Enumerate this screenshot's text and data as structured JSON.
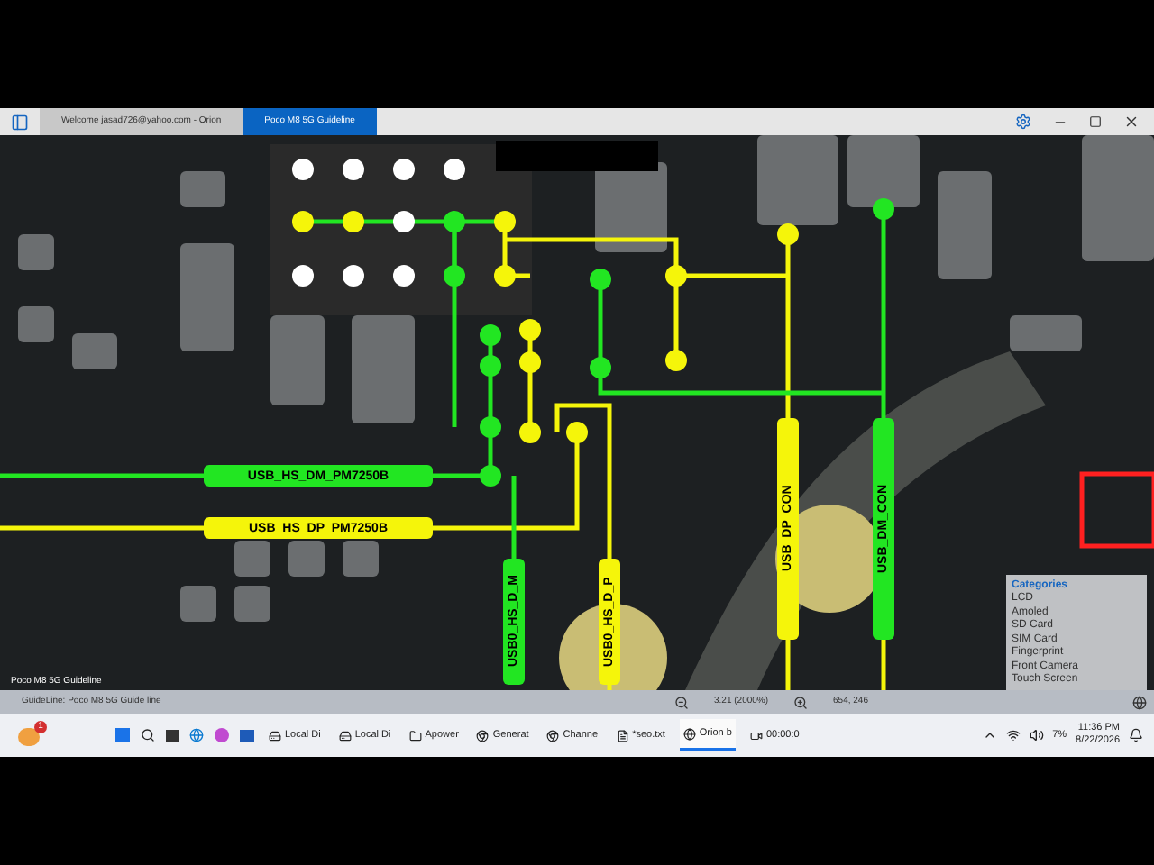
{
  "window": {
    "tabs": [
      {
        "label": "Welcome jasad726@yahoo.com - Orion",
        "selected": false
      },
      {
        "label": "Poco M8 5G Guideline",
        "selected": true
      }
    ]
  },
  "canvas": {
    "caption": "Poco M8 5G Guideline",
    "nets": [
      {
        "label": "USB_HS_DM_PM7250B",
        "kind": "horizontal",
        "color": "#22e622"
      },
      {
        "label": "USB_HS_DP_PM7250B",
        "kind": "horizontal",
        "color": "#f5f50a"
      },
      {
        "label": "USB_DP_CON",
        "kind": "vertical",
        "color": "#f5f50a"
      },
      {
        "label": "USB_DM_CON",
        "kind": "vertical",
        "color": "#22e622"
      },
      {
        "label": "USB0_HS_D_M",
        "kind": "vertical",
        "color": "#22e622"
      },
      {
        "label": "USB0_HS_D_P",
        "kind": "vertical",
        "color": "#f5f50a"
      }
    ]
  },
  "categories": {
    "title": "Categories",
    "items": [
      "LCD",
      "Amoled",
      "SD Card",
      "SIM Card",
      "Fingerprint",
      "Front Camera",
      "Touch Screen"
    ]
  },
  "status_bar": {
    "guideline": "GuideLine: Poco M8 5G Guide line",
    "zoom": "3.21 (2000%)",
    "coords": "654, 246"
  },
  "taskbar": {
    "notification_count": "1",
    "apps": [
      {
        "label": "Local Di",
        "kind": "drive",
        "active": false
      },
      {
        "label": "Local Di",
        "kind": "drive",
        "active": false
      },
      {
        "label": "Apower",
        "kind": "folder",
        "active": false
      },
      {
        "label": "Generat",
        "kind": "browser",
        "active": false
      },
      {
        "label": "Channe",
        "kind": "browser",
        "active": false
      },
      {
        "label": "*seo.txt",
        "kind": "notepad",
        "active": false
      },
      {
        "label": "Orion b",
        "kind": "orion",
        "active": true
      },
      {
        "label": "00:00:0",
        "kind": "recorder",
        "active": false
      }
    ],
    "battery": "7%",
    "time": "11:36 PM",
    "date": "8/22/2026"
  }
}
